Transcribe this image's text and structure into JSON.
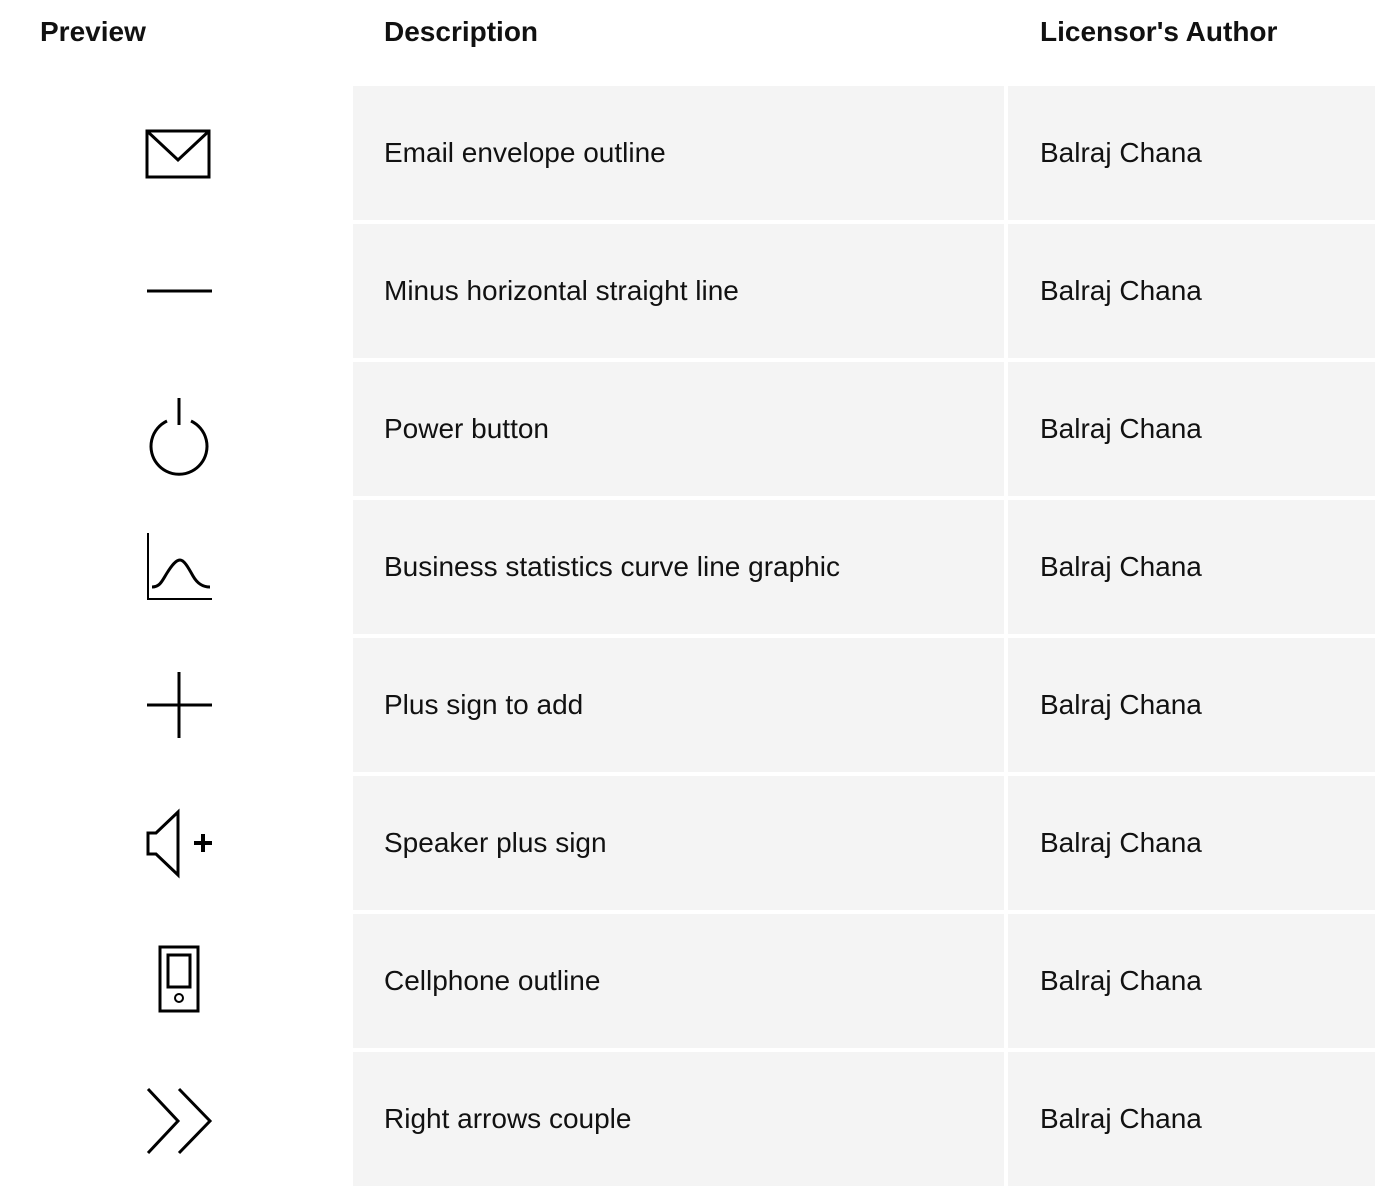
{
  "table": {
    "headers": {
      "preview": "Preview",
      "description": "Description",
      "author": "Licensor's Author"
    },
    "rows": [
      {
        "icon": "envelope-icon",
        "description": "Email envelope outline",
        "author": "Balraj Chana"
      },
      {
        "icon": "minus-icon",
        "description": "Minus horizontal straight line",
        "author": "Balraj Chana"
      },
      {
        "icon": "power-icon",
        "description": "Power button",
        "author": "Balraj Chana"
      },
      {
        "icon": "curve-chart-icon",
        "description": "Business statistics curve line graphic",
        "author": "Balraj Chana"
      },
      {
        "icon": "plus-icon",
        "description": "Plus sign to add",
        "author": "Balraj Chana"
      },
      {
        "icon": "speaker-plus-icon",
        "description": "Speaker plus sign",
        "author": "Balraj Chana"
      },
      {
        "icon": "cellphone-icon",
        "description": "Cellphone outline",
        "author": "Balraj Chana"
      },
      {
        "icon": "double-chevron-right-icon",
        "description": "Right arrows couple",
        "author": "Balraj Chana"
      }
    ]
  }
}
